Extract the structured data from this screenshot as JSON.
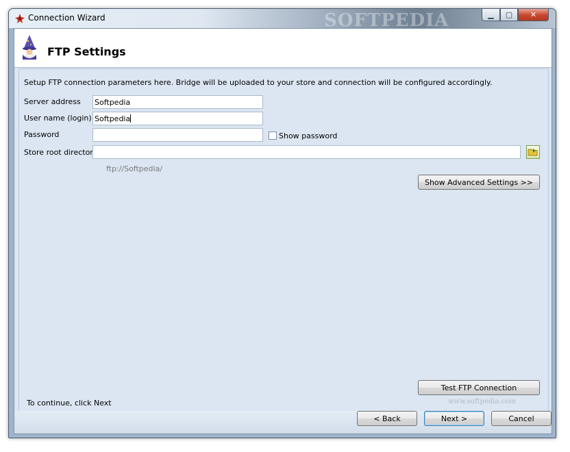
{
  "window": {
    "title": "Connection Wizard",
    "watermark": "SOFTPEDIA"
  },
  "header": {
    "title": "FTP Settings"
  },
  "form": {
    "description": "Setup FTP connection parameters here. Bridge will be uploaded to your store and connection will be configured accordingly.",
    "server_label": "Server address",
    "server_value": "Softpedia",
    "user_label": "User name (login)",
    "user_value": "Softpedia",
    "password_label": "Password",
    "password_value": "",
    "show_password_label": "Show password",
    "show_password_checked": false,
    "root_label": "Store root directory",
    "root_value": "",
    "ftp_hint": "ftp://Softpedia/",
    "advanced_button": "Show Advanced Settings >>",
    "test_button": "Test FTP Connection",
    "continue_text": "To continue, click Next",
    "footer_watermark": "www.softpedia.com"
  },
  "buttons": {
    "back": "< Back",
    "next": "Next >",
    "cancel": "Cancel"
  },
  "icons": {
    "app": "app-logo-icon",
    "wizard": "wizard-icon",
    "browse": "folder-browse-icon"
  }
}
